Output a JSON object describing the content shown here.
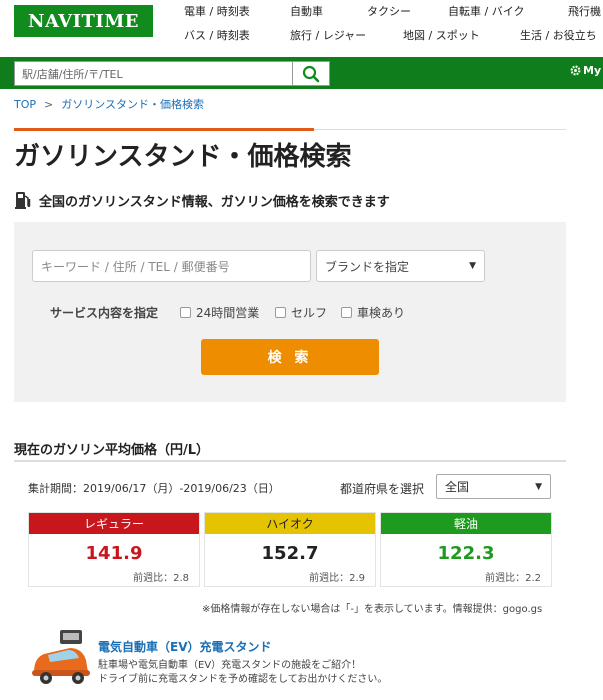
{
  "header": {
    "logo": "NAVITIME",
    "nav_row1": [
      "電車 / 時刻表",
      "自動車",
      "タクシー",
      "自転車 / バイク",
      "飛行機"
    ],
    "nav_row2": [
      "バス / 時刻表",
      "旅行 / レジャー",
      "地図 / スポット",
      "生活 / お役立ち"
    ],
    "search_placeholder": "駅/店舗/住所/〒/TEL",
    "mypage_label": "My"
  },
  "breadcrumb": {
    "top": "TOP",
    "separator": ">",
    "current": "ガソリンスタンド・価格検索"
  },
  "page_title": "ガソリンスタンド・価格検索",
  "subheading": "全国のガソリンスタンド情報、ガソリン価格を検索できます",
  "search_form": {
    "keyword_placeholder": "キーワード / 住所 / TEL / 郵便番号",
    "brand_select": "ブランドを指定",
    "service_label": "サービス内容を指定",
    "options": [
      "24時間営業",
      "セルフ",
      "車検あり"
    ],
    "submit_label": "検 索"
  },
  "prices": {
    "section_title": "現在のガソリン平均価格（円/L）",
    "period": "集計期間：2019/06/17（月）-2019/06/23（日）",
    "prefecture_label": "都道府県を選択",
    "prefecture_value": "全国",
    "cards": [
      {
        "name": "レギュラー",
        "price": "141.9",
        "diff": "前週比：2.8",
        "header_color": "#c8161d",
        "header_text": "#ffffff",
        "price_color": "#c8161d"
      },
      {
        "name": "ハイオク",
        "price": "152.7",
        "diff": "前週比：2.9",
        "header_color": "#e6c300",
        "header_text": "#222222",
        "price_color": "#222222"
      },
      {
        "name": "軽油",
        "price": "122.3",
        "diff": "前週比：2.2",
        "header_color": "#1e9a1e",
        "header_text": "#ffffff",
        "price_color": "#1e9a1e"
      }
    ],
    "note": "※価格情報が存在しない場合は「-」を表示しています。情報提供：gogo.gs"
  },
  "ev": {
    "link": "電気自動車（EV）充電スタンド",
    "desc_line1": "駐車場や電気自動車（EV）充電スタンドの施設をご紹介！",
    "desc_line2": "ドライブ前に充電スタンドを予め確認をしてお出かけください。"
  },
  "colors": {
    "brand_green": "#118b1e",
    "accent_orange": "#ef8d00",
    "title_accent": "#e05a18",
    "link_blue": "#1a6fb5"
  },
  "icons": [
    "search-icon",
    "gear-icon",
    "gas-pump-icon",
    "chevron-down-icon",
    "ev-car-icon"
  ]
}
